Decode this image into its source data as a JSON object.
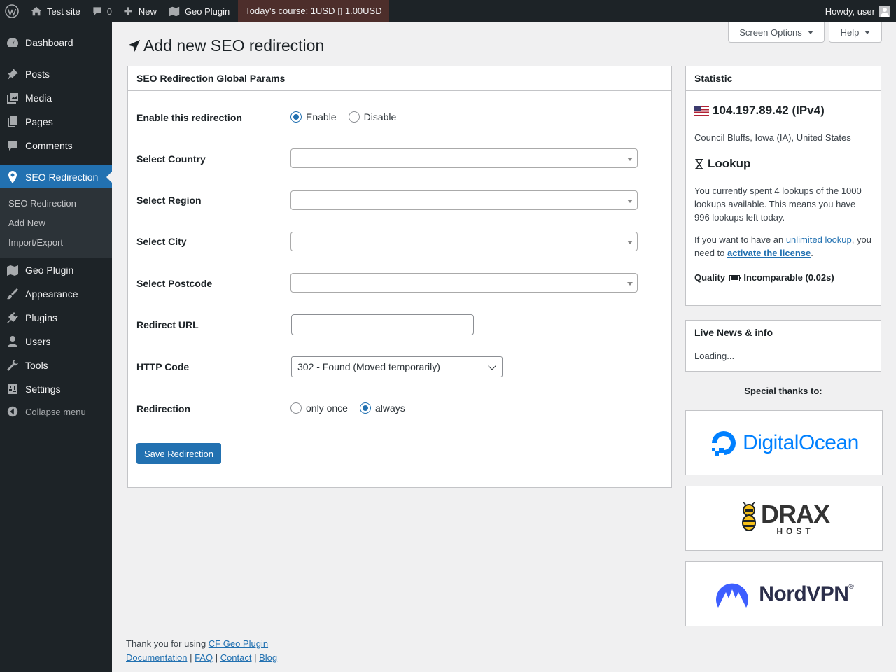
{
  "adminbar": {
    "site_name": "Test site",
    "comments_count": "0",
    "new_label": "New",
    "geo_plugin_label": "Geo Plugin",
    "course_text": "Today's course: 1USD ▯ 1.00USD",
    "howdy": "Howdy, user"
  },
  "sidebar": {
    "items": [
      {
        "label": "Dashboard",
        "icon": "dashboard-icon"
      },
      {
        "label": "Posts",
        "icon": "pin-icon"
      },
      {
        "label": "Media",
        "icon": "media-icon"
      },
      {
        "label": "Pages",
        "icon": "pages-icon"
      },
      {
        "label": "Comments",
        "icon": "comment-icon"
      },
      {
        "label": "SEO Redirection",
        "icon": "location-pin-icon"
      },
      {
        "label": "Geo Plugin",
        "icon": "map-icon"
      },
      {
        "label": "Appearance",
        "icon": "brush-icon"
      },
      {
        "label": "Plugins",
        "icon": "plug-icon"
      },
      {
        "label": "Users",
        "icon": "user-icon"
      },
      {
        "label": "Tools",
        "icon": "wrench-icon"
      },
      {
        "label": "Settings",
        "icon": "settings-icon"
      }
    ],
    "submenu": [
      "SEO Redirection",
      "Add New",
      "Import/Export"
    ],
    "collapse_label": "Collapse menu"
  },
  "screen_options_label": "Screen Options",
  "help_label": "Help",
  "page_title": "Add new SEO redirection",
  "form": {
    "box_title": "SEO Redirection Global Params",
    "enable_label": "Enable this redirection",
    "enable_option": "Enable",
    "disable_option": "Disable",
    "enabled": true,
    "country_label": "Select Country",
    "region_label": "Select Region",
    "city_label": "Select City",
    "postcode_label": "Select Postcode",
    "redirect_url_label": "Redirect URL",
    "redirect_url_value": "",
    "http_code_label": "HTTP Code",
    "http_code_value": "302 - Found (Moved temporarily)",
    "redirection_label": "Redirection",
    "only_once_option": "only once",
    "always_option": "always",
    "redirection_mode": "always",
    "save_label": "Save Redirection"
  },
  "statistic": {
    "title": "Statistic",
    "ip": "104.197.89.42 (IPv4)",
    "location": "Council Bluffs, Iowa (IA), United States",
    "lookup_title": "Lookup",
    "lookup_text": "You currently spent 4 lookups of the 1000 lookups available. This means you have 996 lookups left today.",
    "unlimited_prefix": "If you want to have an ",
    "unlimited_link": "unlimited lookup",
    "unlimited_middle": ", you need to ",
    "license_link": "activate the license",
    "unlimited_suffix": ".",
    "quality_label": "Quality",
    "quality_value": "Incomparable (0.02s)"
  },
  "news": {
    "title": "Live News & info",
    "body": "Loading..."
  },
  "thanks_label": "Special thanks to:",
  "sponsors": {
    "digitalocean": "DigitalOcean",
    "dray_top": "DRAX",
    "dray_bottom": "HOST",
    "nordvpn": "NordVPN",
    "nordvpn_mark": "®"
  },
  "footer": {
    "thanks_prefix": "Thank you for using ",
    "plugin_link": "CF Geo Plugin",
    "links": [
      "Documentation",
      "FAQ",
      "Contact",
      "Blog"
    ],
    "separator": " | "
  },
  "colors": {
    "primary": "#2271b1",
    "adminbar": "#1d2327",
    "submenu": "#2c3338",
    "course_bg": "#4d2e2b"
  }
}
